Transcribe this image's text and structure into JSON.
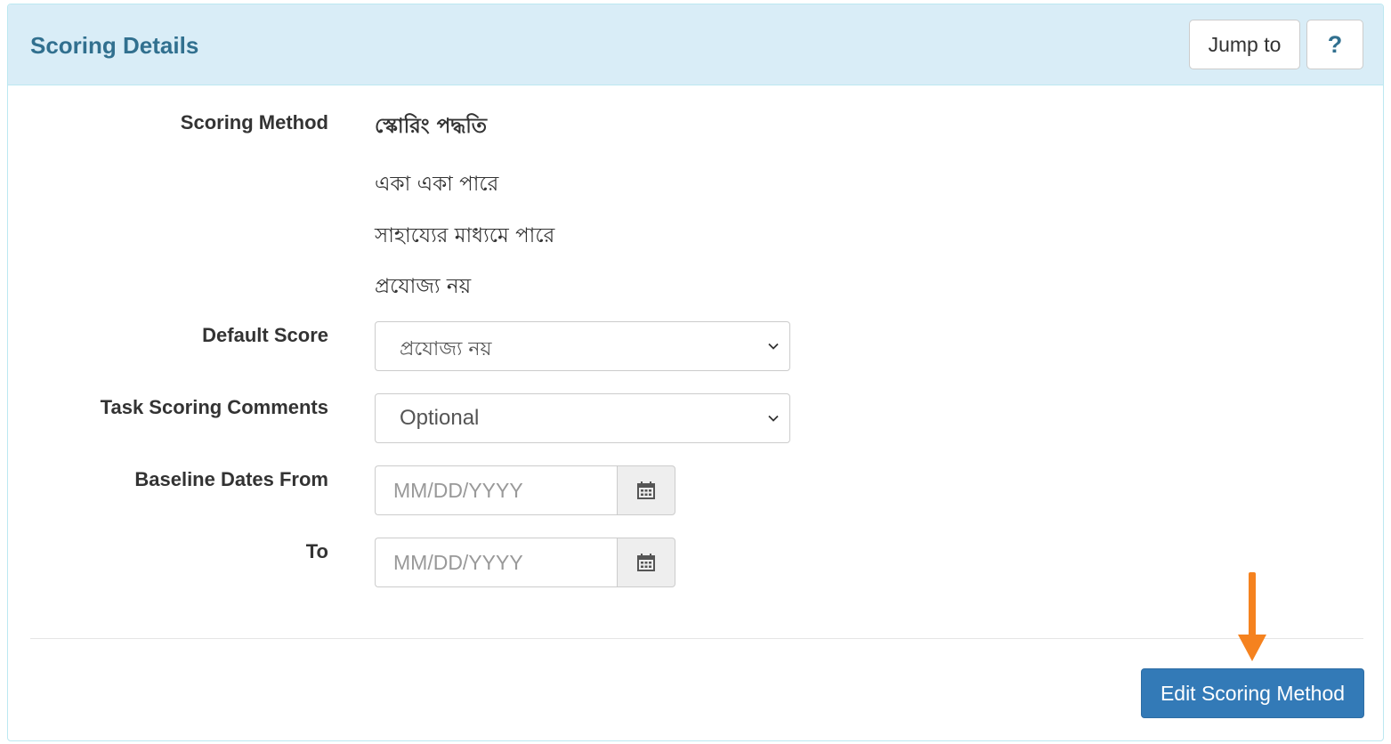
{
  "header": {
    "title": "Scoring Details",
    "jump_label": "Jump to",
    "help_label": "?"
  },
  "form": {
    "scoring_method": {
      "label": "Scoring Method",
      "title": "স্কোরিং পদ্ধতি",
      "options": [
        "একা একা পারে",
        "সাহায্যের মাধ্যমে পারে",
        "প্রযোজ্য নয়"
      ]
    },
    "default_score": {
      "label": "Default Score",
      "value": "প্রযোজ্য নয়"
    },
    "task_comments": {
      "label": "Task Scoring Comments",
      "value": "Optional"
    },
    "baseline_from": {
      "label": "Baseline Dates From",
      "placeholder": "MM/DD/YYYY"
    },
    "baseline_to": {
      "label": "To",
      "placeholder": "MM/DD/YYYY"
    }
  },
  "footer": {
    "edit_label": "Edit Scoring Method"
  },
  "colors": {
    "heading_bg": "#d9edf7",
    "heading_text": "#31708f",
    "primary": "#337ab7",
    "arrow": "#f5821f"
  }
}
